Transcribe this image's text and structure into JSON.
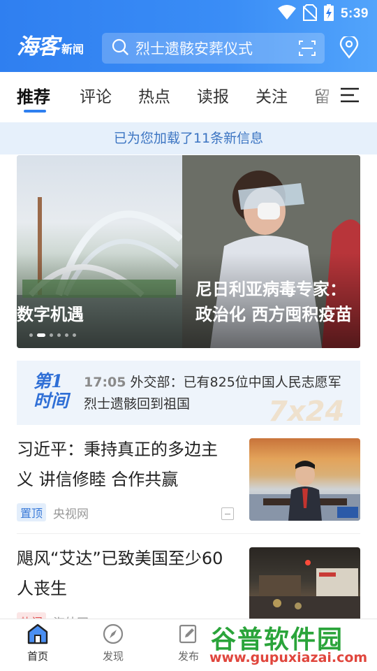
{
  "status_bar": {
    "time": "5:39",
    "icons": [
      "wifi-icon",
      "no-sim-icon",
      "battery-charging-icon"
    ]
  },
  "app_bar": {
    "logo_main": "海客",
    "logo_sub": "新闻",
    "search_placeholder": "烈士遗骸安葬仪式",
    "icons": [
      "search-icon",
      "scan-icon",
      "location-pin-icon"
    ]
  },
  "tabs": {
    "items": [
      "推荐",
      "评论",
      "热点",
      "读报",
      "关注",
      "留"
    ],
    "active_index": 0,
    "menu_icon": "menu-icon"
  },
  "notice": {
    "text": "已为您加载了11条新信息"
  },
  "banner": {
    "caption_left": "数字机遇",
    "caption_right_line1": "尼日利亚病毒专家：",
    "caption_right_line2": "政治化 西方囤积疫苗",
    "slide_count": 6,
    "active_slide": 1
  },
  "flash": {
    "logo_line1": "第1",
    "logo_line2": "时间",
    "time": "17:05",
    "text": "外交部：已有825位中国人民志愿军烈士遗骸回到祖国",
    "watermark": "7x24"
  },
  "news": [
    {
      "title": "习近平：秉持真正的多边主义 讲信修睦 合作共赢",
      "badge": "置顶",
      "source": "央视网"
    },
    {
      "title": "飓风“艾达”已致美国至少60人丧生",
      "badge": "热门",
      "source": "海外网"
    }
  ],
  "bottom_nav": {
    "items": [
      {
        "label": "首页",
        "icon": "home-icon"
      },
      {
        "label": "发现",
        "icon": "compass-icon"
      },
      {
        "label": "发布",
        "icon": "edit-icon"
      }
    ],
    "active_index": 0
  },
  "watermark": {
    "main": "谷普软件园",
    "url": "www.gupuxiazai.com"
  },
  "colors": {
    "brand_blue": "#2f7ff0",
    "notice_bg": "#e6f0fb",
    "notice_text": "#3b74c2",
    "badge_blue": "#3b7bd8",
    "badge_red": "#e05050"
  }
}
